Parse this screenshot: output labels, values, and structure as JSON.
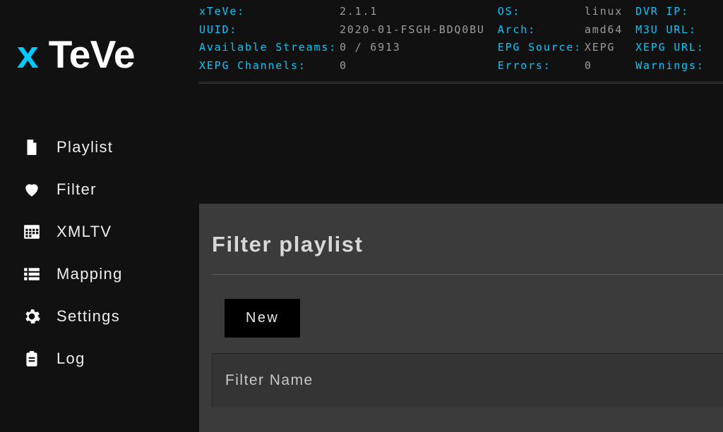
{
  "logo": {
    "x": "x",
    "rest": " TeVe"
  },
  "nav": {
    "items": [
      {
        "label": "Playlist"
      },
      {
        "label": "Filter"
      },
      {
        "label": "XMLTV"
      },
      {
        "label": "Mapping"
      },
      {
        "label": "Settings"
      },
      {
        "label": "Log"
      }
    ]
  },
  "info": {
    "xteve_label": "xTeVe:",
    "xteve_val": "2.1.1",
    "uuid_label": "UUID:",
    "uuid_val": "2020-01-FSGH-BDQ0BU",
    "avail_label": "Available Streams:",
    "avail_val": "0 / 6913",
    "xepgch_label": "XEPG Channels:",
    "xepgch_val": "0",
    "os_label": "OS:",
    "os_val": "linux",
    "arch_label": "Arch:",
    "arch_val": "amd64",
    "epg_label": "EPG Source:",
    "epg_val": "XEPG",
    "err_label": "Errors:",
    "err_val": "0",
    "dvr_label": "DVR IP:",
    "m3u_label": "M3U URL:",
    "xepgurl_label": "XEPG URL:",
    "warn_label": "Warnings:"
  },
  "page": {
    "title": "Filter playlist",
    "new_button": "New",
    "column_filter_name": "Filter Name"
  }
}
